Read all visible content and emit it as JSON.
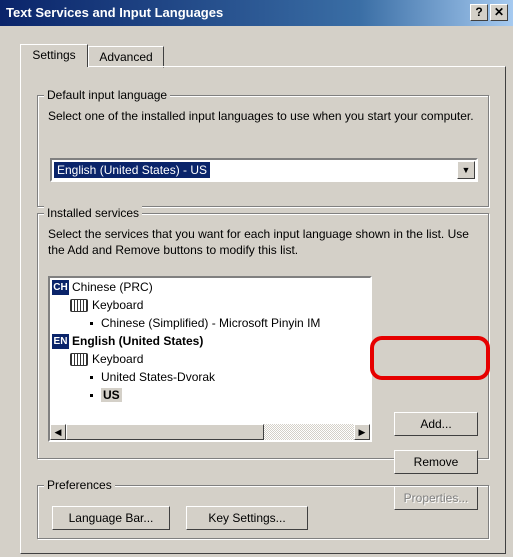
{
  "window": {
    "title": "Text Services and Input Languages",
    "help_button": "?",
    "close_button": "✕"
  },
  "tabs": [
    {
      "label": "Settings",
      "selected": true
    },
    {
      "label": "Advanced",
      "selected": false
    }
  ],
  "default_input": {
    "legend": "Default input language",
    "description": "Select one of the installed input languages to use when you start your computer.",
    "selected_value": "English (United States) - US"
  },
  "installed_services": {
    "legend": "Installed services",
    "description": "Select the services that you want for each input language shown in the list. Use the Add and Remove buttons to modify this list.",
    "items": [
      {
        "code": "CH",
        "label": "Chinese (PRC)"
      },
      {
        "label": "Keyboard"
      },
      {
        "label": "Chinese (Simplified) - Microsoft Pinyin IM"
      },
      {
        "code": "EN",
        "label": "English (United States)"
      },
      {
        "label": "Keyboard"
      },
      {
        "label": "United States-Dvorak"
      },
      {
        "label": "US"
      }
    ],
    "buttons": {
      "add": "Add...",
      "remove": "Remove",
      "properties": "Properties..."
    }
  },
  "preferences": {
    "legend": "Preferences",
    "language_bar": "Language Bar...",
    "key_settings": "Key Settings..."
  },
  "colors": {
    "titlebar": "#0a246a",
    "highlight_annotation": "#e60000"
  }
}
